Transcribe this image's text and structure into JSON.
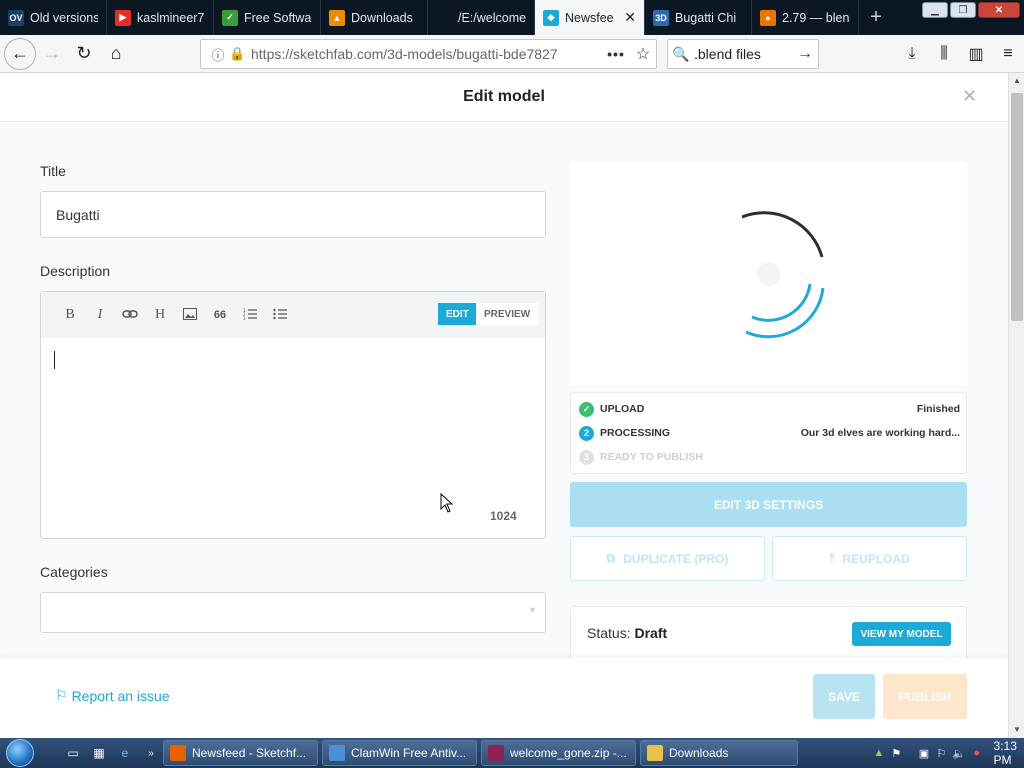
{
  "browser": {
    "tabs": [
      {
        "label": "Old versions",
        "icon": "ov-icon",
        "icon_text": "OV",
        "icon_bg": "#1b3f6b",
        "active": false
      },
      {
        "label": "kaslmineer7",
        "icon": "youtube-icon",
        "icon_text": "▶",
        "icon_bg": "#e52d27",
        "active": false
      },
      {
        "label": "Free Softwa",
        "icon": "free-software-icon",
        "icon_text": "✓",
        "icon_bg": "#3a9d3a",
        "active": false
      },
      {
        "label": "Downloads",
        "icon": "vlc-cone-icon",
        "icon_text": "▲",
        "icon_bg": "#f08a00",
        "active": false
      },
      {
        "label": "/E:/welcome_go",
        "icon": "file-icon",
        "icon_text": "",
        "icon_bg": "#0c1724",
        "active": false
      },
      {
        "label": "Newsfee",
        "icon": "sketchfab-icon",
        "icon_text": "◆",
        "icon_bg": "#1caad9",
        "active": true
      },
      {
        "label": "Bugatti Chi",
        "icon": "3d-icon",
        "icon_text": "3D",
        "icon_bg": "#2b6cb0",
        "active": false
      },
      {
        "label": "2.79 — blen",
        "icon": "blender-icon",
        "icon_text": "●",
        "icon_bg": "#ea7600",
        "active": false
      }
    ],
    "url": "https://sketchfab.com/3d-models/bugatti-bde7827",
    "search_text": ".blend files"
  },
  "modal": {
    "title": "Edit model",
    "title_label": "Title",
    "title_value": "Bugatti",
    "description_label": "Description",
    "editor_modes": {
      "edit": "EDIT",
      "preview": "PREVIEW"
    },
    "toolbar": [
      "B",
      "I",
      "🔗",
      "H",
      "▣",
      "66",
      "≡",
      "☰"
    ],
    "char_count": "1024",
    "categories_label": "Categories",
    "steps": [
      {
        "name": "UPLOAD",
        "status": "Finished",
        "icon": "check-icon",
        "icon_text": "✓",
        "color": "#38c172",
        "disabled": false
      },
      {
        "name": "PROCESSING",
        "status": "Our 3d elves are working hard...",
        "icon": "step-2-icon",
        "icon_text": "2",
        "color": "#1caad9",
        "disabled": false
      },
      {
        "name": "READY TO PUBLISH",
        "status": "",
        "icon": "step-3-icon",
        "icon_text": "3",
        "color": "#dde1e5",
        "disabled": true
      }
    ],
    "edit_3d_button": "EDIT 3D SETTINGS",
    "duplicate_button": "DUPLICATE (PRO)",
    "reupload_button": "REUPLOAD",
    "status_label": "Status:",
    "status_value": "Draft",
    "view_model_button": "VIEW MY MODEL",
    "report_issue": "Report an issue",
    "save_button": "SAVE",
    "publish_button": "PUBLISH"
  },
  "taskbar": {
    "buttons": [
      {
        "label": "Newsfeed - Sketchf...",
        "icon": "firefox-icon",
        "color": "#e66000"
      },
      {
        "label": "ClamWin Free Antiv...",
        "icon": "clamwin-icon",
        "color": "#4a90d9"
      },
      {
        "label": "welcome_gone.zip -...",
        "icon": "winrar-icon",
        "color": "#8b2252"
      },
      {
        "label": "Downloads",
        "icon": "folder-icon",
        "color": "#e8c04a"
      }
    ],
    "clock": "3:13 PM"
  },
  "colors": {
    "accent": "#1caad9",
    "publish": "#fde6cc",
    "success": "#38c172"
  }
}
